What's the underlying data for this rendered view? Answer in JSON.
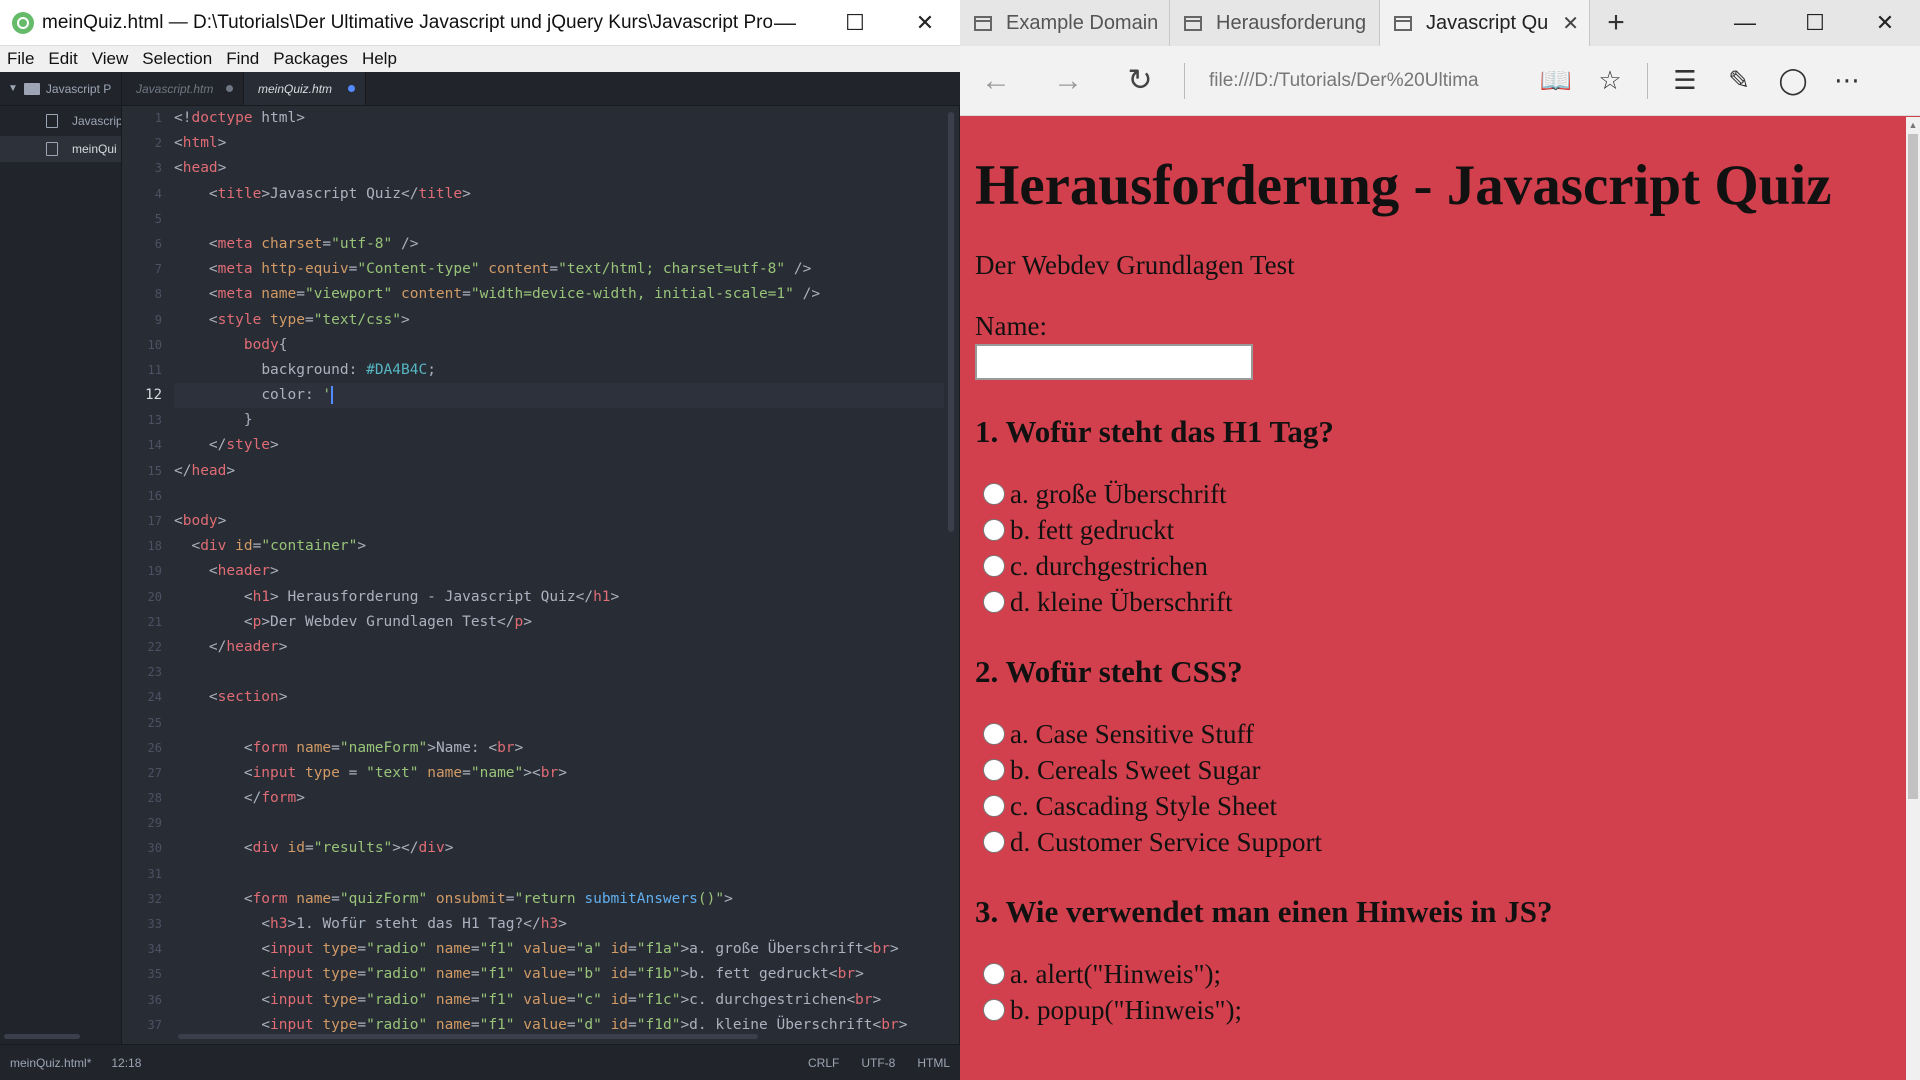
{
  "editor": {
    "window_title": "meinQuiz.html — D:\\Tutorials\\Der Ultimative Javascript und jQuery Kurs\\Javascript Proje...",
    "menu": [
      "File",
      "Edit",
      "View",
      "Selection",
      "Find",
      "Packages",
      "Help"
    ],
    "tree_root": "Javascript P",
    "tabs": [
      {
        "label": "Javascript.htm",
        "active": false,
        "modified": true
      },
      {
        "label": "meinQuiz.htm",
        "active": true,
        "modified": true
      }
    ],
    "tree_files": [
      "Javascrip",
      "meinQui"
    ],
    "current_line": 12,
    "status": {
      "file": "meinQuiz.html*",
      "cursor": "12:18",
      "line_ending": "CRLF",
      "encoding": "UTF-8",
      "grammar": "HTML"
    }
  },
  "browser": {
    "tabs": [
      {
        "label": "Example Domain",
        "active": false
      },
      {
        "label": "Herausforderung",
        "active": false
      },
      {
        "label": "Javascript Qu",
        "active": true
      }
    ],
    "address": "file:///D:/Tutorials/Der%20Ultima",
    "page": {
      "title": "Herausforderung - Javascript Quiz",
      "subtitle": "Der Webdev Grundlagen Test",
      "name_label": "Name:",
      "questions": [
        {
          "q": "1. Wofür steht das H1 Tag?",
          "options": [
            "a. große Überschrift",
            "b. fett gedruckt",
            "c. durchgestrichen",
            "d. kleine Überschrift"
          ]
        },
        {
          "q": "2. Wofür steht CSS?",
          "options": [
            "a. Case Sensitive Stuff",
            "b. Cereals Sweet Sugar",
            "c. Cascading Style Sheet",
            "d. Customer Service Support"
          ]
        },
        {
          "q": "3. Wie verwendet man einen Hinweis in JS?",
          "options": [
            "a. alert(\"Hinweis\");",
            "b. popup(\"Hinweis\");"
          ]
        }
      ]
    }
  },
  "code_lines": [
    {
      "n": 1,
      "tokens": [
        [
          "t-pun",
          "<!"
        ],
        [
          "t-tag",
          "doctype"
        ],
        [
          "t-txt",
          " html"
        ],
        [
          "t-pun",
          ">"
        ]
      ]
    },
    {
      "n": 2,
      "tokens": [
        [
          "t-pun",
          "<"
        ],
        [
          "t-tag",
          "html"
        ],
        [
          "t-pun",
          ">"
        ]
      ]
    },
    {
      "n": 3,
      "tokens": [
        [
          "t-pun",
          "<"
        ],
        [
          "t-tag",
          "head"
        ],
        [
          "t-pun",
          ">"
        ]
      ]
    },
    {
      "n": 4,
      "tokens": [
        [
          "t-txt",
          "    "
        ],
        [
          "t-pun",
          "<"
        ],
        [
          "t-tag",
          "title"
        ],
        [
          "t-pun",
          ">"
        ],
        [
          "t-txt",
          "Javascript Quiz"
        ],
        [
          "t-pun",
          "</"
        ],
        [
          "t-tag",
          "title"
        ],
        [
          "t-pun",
          ">"
        ]
      ]
    },
    {
      "n": 5,
      "tokens": []
    },
    {
      "n": 6,
      "tokens": [
        [
          "t-txt",
          "    "
        ],
        [
          "t-pun",
          "<"
        ],
        [
          "t-tag",
          "meta"
        ],
        [
          "t-attr",
          " charset"
        ],
        [
          "t-pun",
          "="
        ],
        [
          "t-str",
          "\"utf-8\""
        ],
        [
          "t-pun",
          " />"
        ]
      ]
    },
    {
      "n": 7,
      "tokens": [
        [
          "t-txt",
          "    "
        ],
        [
          "t-pun",
          "<"
        ],
        [
          "t-tag",
          "meta"
        ],
        [
          "t-attr",
          " http-equiv"
        ],
        [
          "t-pun",
          "="
        ],
        [
          "t-str",
          "\"Content-type\""
        ],
        [
          "t-attr",
          " content"
        ],
        [
          "t-pun",
          "="
        ],
        [
          "t-str",
          "\"text/html; charset=utf-8\""
        ],
        [
          "t-pun",
          " />"
        ]
      ]
    },
    {
      "n": 8,
      "tokens": [
        [
          "t-txt",
          "    "
        ],
        [
          "t-pun",
          "<"
        ],
        [
          "t-tag",
          "meta"
        ],
        [
          "t-attr",
          " name"
        ],
        [
          "t-pun",
          "="
        ],
        [
          "t-str",
          "\"viewport\""
        ],
        [
          "t-attr",
          " content"
        ],
        [
          "t-pun",
          "="
        ],
        [
          "t-str",
          "\"width=device-width, initial-scale=1\""
        ],
        [
          "t-pun",
          " />"
        ]
      ]
    },
    {
      "n": 9,
      "tokens": [
        [
          "t-txt",
          "    "
        ],
        [
          "t-pun",
          "<"
        ],
        [
          "t-tag",
          "style"
        ],
        [
          "t-attr",
          " type"
        ],
        [
          "t-pun",
          "="
        ],
        [
          "t-str",
          "\"text/css\""
        ],
        [
          "t-pun",
          ">"
        ]
      ]
    },
    {
      "n": 10,
      "tokens": [
        [
          "t-txt",
          "        "
        ],
        [
          "t-sel",
          "body"
        ],
        [
          "t-pun",
          "{"
        ]
      ]
    },
    {
      "n": 11,
      "tokens": [
        [
          "t-txt",
          "          "
        ],
        [
          "t-prop",
          "background"
        ],
        [
          "t-pun",
          ": "
        ],
        [
          "t-num",
          "#DA4B4C"
        ],
        [
          "t-pun",
          ";"
        ]
      ]
    },
    {
      "n": 12,
      "tokens": [
        [
          "t-txt",
          "          "
        ],
        [
          "t-prop",
          "color"
        ],
        [
          "t-pun",
          ":"
        ],
        [
          "t-str",
          " '"
        ]
      ],
      "cursor": true
    },
    {
      "n": 13,
      "tokens": [
        [
          "t-txt",
          "        "
        ],
        [
          "t-pun",
          "}"
        ]
      ]
    },
    {
      "n": 14,
      "tokens": [
        [
          "t-txt",
          "    "
        ],
        [
          "t-pun",
          "</"
        ],
        [
          "t-tag",
          "style"
        ],
        [
          "t-pun",
          ">"
        ]
      ]
    },
    {
      "n": 15,
      "tokens": [
        [
          "t-pun",
          "</"
        ],
        [
          "t-tag",
          "head"
        ],
        [
          "t-pun",
          ">"
        ]
      ]
    },
    {
      "n": 16,
      "tokens": []
    },
    {
      "n": 17,
      "tokens": [
        [
          "t-pun",
          "<"
        ],
        [
          "t-tag",
          "body"
        ],
        [
          "t-pun",
          ">"
        ]
      ]
    },
    {
      "n": 18,
      "tokens": [
        [
          "t-txt",
          "  "
        ],
        [
          "t-pun",
          "<"
        ],
        [
          "t-tag",
          "div"
        ],
        [
          "t-attr",
          " id"
        ],
        [
          "t-pun",
          "="
        ],
        [
          "t-str",
          "\"container\""
        ],
        [
          "t-pun",
          ">"
        ]
      ]
    },
    {
      "n": 19,
      "tokens": [
        [
          "t-txt",
          "    "
        ],
        [
          "t-pun",
          "<"
        ],
        [
          "t-tag",
          "header"
        ],
        [
          "t-pun",
          ">"
        ]
      ]
    },
    {
      "n": 20,
      "tokens": [
        [
          "t-txt",
          "        "
        ],
        [
          "t-pun",
          "<"
        ],
        [
          "t-tag",
          "h1"
        ],
        [
          "t-pun",
          ">"
        ],
        [
          "t-txt",
          " Herausforderung - Javascript Quiz"
        ],
        [
          "t-pun",
          "</"
        ],
        [
          "t-tag",
          "h1"
        ],
        [
          "t-pun",
          ">"
        ]
      ]
    },
    {
      "n": 21,
      "tokens": [
        [
          "t-txt",
          "        "
        ],
        [
          "t-pun",
          "<"
        ],
        [
          "t-tag",
          "p"
        ],
        [
          "t-pun",
          ">"
        ],
        [
          "t-txt",
          "Der Webdev Grundlagen Test"
        ],
        [
          "t-pun",
          "</"
        ],
        [
          "t-tag",
          "p"
        ],
        [
          "t-pun",
          ">"
        ]
      ]
    },
    {
      "n": 22,
      "tokens": [
        [
          "t-txt",
          "    "
        ],
        [
          "t-pun",
          "</"
        ],
        [
          "t-tag",
          "header"
        ],
        [
          "t-pun",
          ">"
        ]
      ]
    },
    {
      "n": 23,
      "tokens": []
    },
    {
      "n": 24,
      "tokens": [
        [
          "t-txt",
          "    "
        ],
        [
          "t-pun",
          "<"
        ],
        [
          "t-tag",
          "section"
        ],
        [
          "t-pun",
          ">"
        ]
      ]
    },
    {
      "n": 25,
      "tokens": []
    },
    {
      "n": 26,
      "tokens": [
        [
          "t-txt",
          "        "
        ],
        [
          "t-pun",
          "<"
        ],
        [
          "t-tag",
          "form"
        ],
        [
          "t-attr",
          " name"
        ],
        [
          "t-pun",
          "="
        ],
        [
          "t-str",
          "\"nameForm\""
        ],
        [
          "t-pun",
          ">"
        ],
        [
          "t-txt",
          "Name: "
        ],
        [
          "t-pun",
          "<"
        ],
        [
          "t-tag",
          "br"
        ],
        [
          "t-pun",
          ">"
        ]
      ]
    },
    {
      "n": 27,
      "tokens": [
        [
          "t-txt",
          "        "
        ],
        [
          "t-pun",
          "<"
        ],
        [
          "t-tag",
          "input"
        ],
        [
          "t-attr",
          " type"
        ],
        [
          "t-pun",
          " = "
        ],
        [
          "t-str",
          "\"text\""
        ],
        [
          "t-attr",
          " name"
        ],
        [
          "t-pun",
          "="
        ],
        [
          "t-str",
          "\"name\""
        ],
        [
          "t-pun",
          ">"
        ],
        [
          "t-pun",
          "<"
        ],
        [
          "t-tag",
          "br"
        ],
        [
          "t-pun",
          ">"
        ]
      ]
    },
    {
      "n": 28,
      "tokens": [
        [
          "t-txt",
          "        "
        ],
        [
          "t-pun",
          "</"
        ],
        [
          "t-tag",
          "form"
        ],
        [
          "t-pun",
          ">"
        ]
      ]
    },
    {
      "n": 29,
      "tokens": []
    },
    {
      "n": 30,
      "tokens": [
        [
          "t-txt",
          "        "
        ],
        [
          "t-pun",
          "<"
        ],
        [
          "t-tag",
          "div"
        ],
        [
          "t-attr",
          " id"
        ],
        [
          "t-pun",
          "="
        ],
        [
          "t-str",
          "\"results\""
        ],
        [
          "t-pun",
          "></"
        ],
        [
          "t-tag",
          "div"
        ],
        [
          "t-pun",
          ">"
        ]
      ]
    },
    {
      "n": 31,
      "tokens": []
    },
    {
      "n": 32,
      "tokens": [
        [
          "t-txt",
          "        "
        ],
        [
          "t-pun",
          "<"
        ],
        [
          "t-tag",
          "form"
        ],
        [
          "t-attr",
          " name"
        ],
        [
          "t-pun",
          "="
        ],
        [
          "t-str",
          "\"quizForm\""
        ],
        [
          "t-attr",
          " onsubmit"
        ],
        [
          "t-pun",
          "="
        ],
        [
          "t-str",
          "\"return "
        ],
        [
          "t-fn",
          "submitAnswers"
        ],
        [
          "t-str",
          "()\""
        ],
        [
          "t-pun",
          ">"
        ]
      ]
    },
    {
      "n": 33,
      "tokens": [
        [
          "t-txt",
          "          "
        ],
        [
          "t-pun",
          "<"
        ],
        [
          "t-tag",
          "h3"
        ],
        [
          "t-pun",
          ">"
        ],
        [
          "t-txt",
          "1. Wofür steht das H1 Tag?"
        ],
        [
          "t-pun",
          "</"
        ],
        [
          "t-tag",
          "h3"
        ],
        [
          "t-pun",
          ">"
        ]
      ]
    },
    {
      "n": 34,
      "tokens": [
        [
          "t-txt",
          "          "
        ],
        [
          "t-pun",
          "<"
        ],
        [
          "t-tag",
          "input"
        ],
        [
          "t-attr",
          " type"
        ],
        [
          "t-pun",
          "="
        ],
        [
          "t-str",
          "\"radio\""
        ],
        [
          "t-attr",
          " name"
        ],
        [
          "t-pun",
          "="
        ],
        [
          "t-str",
          "\"f1\""
        ],
        [
          "t-attr",
          " value"
        ],
        [
          "t-pun",
          "="
        ],
        [
          "t-str",
          "\"a\""
        ],
        [
          "t-attr",
          " id"
        ],
        [
          "t-pun",
          "="
        ],
        [
          "t-str",
          "\"f1a\""
        ],
        [
          "t-pun",
          ">"
        ],
        [
          "t-txt",
          "a. große Überschrift"
        ],
        [
          "t-pun",
          "<"
        ],
        [
          "t-tag",
          "br"
        ],
        [
          "t-pun",
          ">"
        ]
      ]
    },
    {
      "n": 35,
      "tokens": [
        [
          "t-txt",
          "          "
        ],
        [
          "t-pun",
          "<"
        ],
        [
          "t-tag",
          "input"
        ],
        [
          "t-attr",
          " type"
        ],
        [
          "t-pun",
          "="
        ],
        [
          "t-str",
          "\"radio\""
        ],
        [
          "t-attr",
          " name"
        ],
        [
          "t-pun",
          "="
        ],
        [
          "t-str",
          "\"f1\""
        ],
        [
          "t-attr",
          " value"
        ],
        [
          "t-pun",
          "="
        ],
        [
          "t-str",
          "\"b\""
        ],
        [
          "t-attr",
          " id"
        ],
        [
          "t-pun",
          "="
        ],
        [
          "t-str",
          "\"f1b\""
        ],
        [
          "t-pun",
          ">"
        ],
        [
          "t-txt",
          "b. fett gedruckt"
        ],
        [
          "t-pun",
          "<"
        ],
        [
          "t-tag",
          "br"
        ],
        [
          "t-pun",
          ">"
        ]
      ]
    },
    {
      "n": 36,
      "tokens": [
        [
          "t-txt",
          "          "
        ],
        [
          "t-pun",
          "<"
        ],
        [
          "t-tag",
          "input"
        ],
        [
          "t-attr",
          " type"
        ],
        [
          "t-pun",
          "="
        ],
        [
          "t-str",
          "\"radio\""
        ],
        [
          "t-attr",
          " name"
        ],
        [
          "t-pun",
          "="
        ],
        [
          "t-str",
          "\"f1\""
        ],
        [
          "t-attr",
          " value"
        ],
        [
          "t-pun",
          "="
        ],
        [
          "t-str",
          "\"c\""
        ],
        [
          "t-attr",
          " id"
        ],
        [
          "t-pun",
          "="
        ],
        [
          "t-str",
          "\"f1c\""
        ],
        [
          "t-pun",
          ">"
        ],
        [
          "t-txt",
          "c. durchgestrichen"
        ],
        [
          "t-pun",
          "<"
        ],
        [
          "t-tag",
          "br"
        ],
        [
          "t-pun",
          ">"
        ]
      ]
    },
    {
      "n": 37,
      "tokens": [
        [
          "t-txt",
          "          "
        ],
        [
          "t-pun",
          "<"
        ],
        [
          "t-tag",
          "input"
        ],
        [
          "t-attr",
          " type"
        ],
        [
          "t-pun",
          "="
        ],
        [
          "t-str",
          "\"radio\""
        ],
        [
          "t-attr",
          " name"
        ],
        [
          "t-pun",
          "="
        ],
        [
          "t-str",
          "\"f1\""
        ],
        [
          "t-attr",
          " value"
        ],
        [
          "t-pun",
          "="
        ],
        [
          "t-str",
          "\"d\""
        ],
        [
          "t-attr",
          " id"
        ],
        [
          "t-pun",
          "="
        ],
        [
          "t-str",
          "\"f1d\""
        ],
        [
          "t-pun",
          ">"
        ],
        [
          "t-txt",
          "d. kleine Überschrift"
        ],
        [
          "t-pun",
          "<"
        ],
        [
          "t-tag",
          "br"
        ],
        [
          "t-pun",
          ">"
        ]
      ]
    }
  ]
}
